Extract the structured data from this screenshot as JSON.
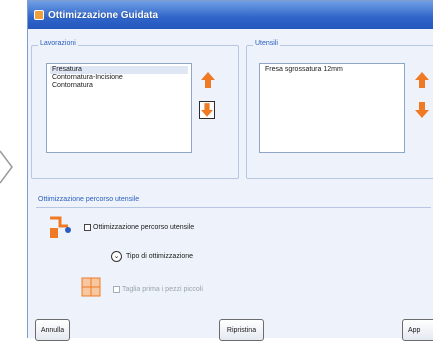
{
  "window": {
    "title": "Ottimizzazione Guidata"
  },
  "lavorazioni": {
    "legend": "Lavorazioni",
    "items": [
      "Fresatura",
      "Contornatura-Incisione",
      "Contornatura"
    ],
    "selected_index": 0
  },
  "utensili": {
    "legend": "Utensili",
    "items": [
      "Fresa sgrossatura 12mm"
    ]
  },
  "ottimizzazione": {
    "section_title": "Ottimizzazione percorso utensile",
    "checkbox_label": "Ottimizzazione percorso utensile",
    "tipo_label": "Tipo di ottimizzazione",
    "taglia_label": "Taglia prima i pezzi piccoli"
  },
  "buttons": {
    "annulla": "Annulla",
    "ripristina": "Ripristina",
    "applica_partial": "App"
  },
  "colors": {
    "accent": "#2a5dbd",
    "arrow": "#f07a24",
    "title_bar": "#2f64c8"
  },
  "icons": {
    "up": "arrow-up-icon",
    "down": "arrow-down-icon",
    "tool": "tool-path-icon",
    "pieces": "small-pieces-icon"
  }
}
